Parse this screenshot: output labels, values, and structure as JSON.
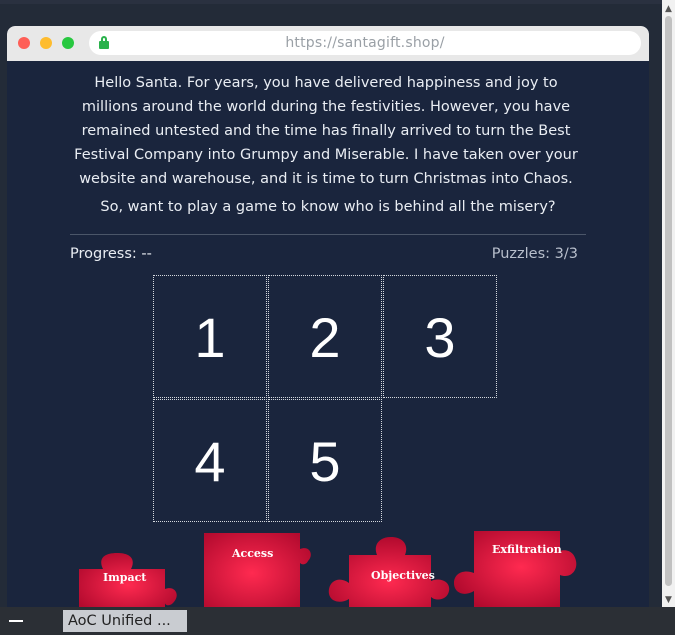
{
  "browser": {
    "url": "https://santagift.shop/"
  },
  "page": {
    "intro_text": "Hello Santa. For years, you have delivered happiness and joy to millions around the world during the festivities. However, you have remained untested and the time has finally arrived to turn the Best Festival Company into Grumpy and Miserable. I have taken over your website and warehouse, and it is time to turn Christmas into Chaos.",
    "question": "So, want to play a game to know who is behind all the misery?",
    "progress": "Progress: --",
    "puzzles": "Puzzles: 3/3",
    "tiles": [
      "1",
      "2",
      "3",
      "4",
      "5"
    ],
    "pieces": [
      "Impact",
      "Access",
      "Objectives",
      "Exfiltration"
    ]
  },
  "taskbar": {
    "item_label": "AoC Unified ..."
  },
  "colors": {
    "page_bg": "#1a253d",
    "piece_red": "#d4123a",
    "lock_green": "#2bb24c"
  }
}
